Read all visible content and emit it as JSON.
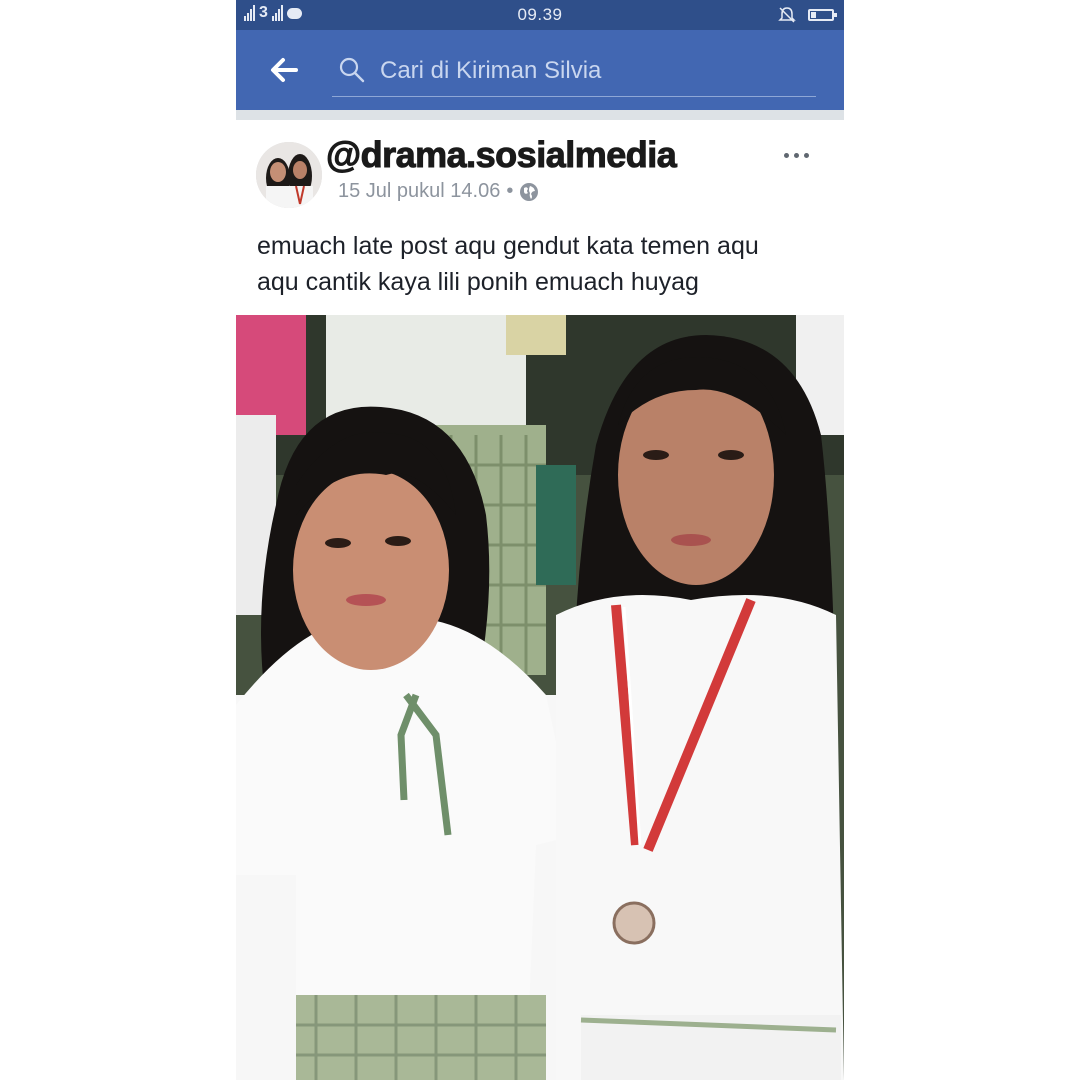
{
  "status_bar": {
    "signal_1_label": "1",
    "network_badge": "3",
    "signal_2_label": "1",
    "time": "09.39",
    "icons": [
      "signal-icon",
      "notification-badge-icon",
      "line-app-icon",
      "mute-icon",
      "battery-icon"
    ]
  },
  "header": {
    "back_icon": "arrow-left-icon",
    "search_icon": "search-icon",
    "search_placeholder": "Cari di Kiriman Silvia",
    "background": "#4267b2"
  },
  "post": {
    "author": "@drama.sosialmedia",
    "timestamp": "15 Jul pukul 14.06",
    "separator": "•",
    "privacy_icon": "globe-icon",
    "more_icon": "more-horizontal-icon",
    "text_lines": [
      "emuach late post aqu gendut kata temen aqu",
      "aqu cantik kaya lili ponih emuach huyag"
    ],
    "photo_description": "two-girls-school-uniform-photo"
  }
}
